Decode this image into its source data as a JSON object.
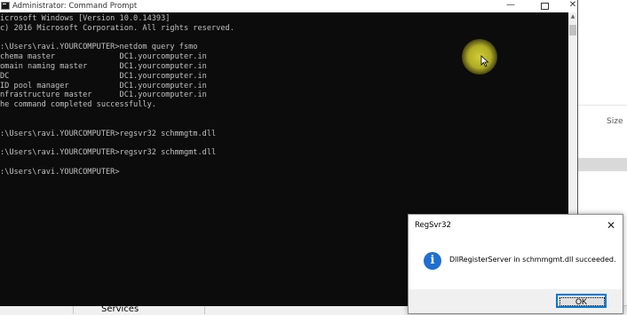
{
  "cmd_window": {
    "title": "Administrator: Command Prompt",
    "minimize_glyph": "—",
    "close_glyph": "✕",
    "console_lines": [
      "icrosoft Windows [Version 10.0.14393]",
      "c) 2016 Microsoft Corporation. All rights reserved.",
      "",
      ":\\Users\\ravi.YOURCOMPUTER>netdom query fsmo",
      "chema master              DC1.yourcomputer.in",
      "omain naming master       DC1.yourcomputer.in",
      "DC                        DC1.yourcomputer.in",
      "ID pool manager           DC1.yourcomputer.in",
      "nfrastructure master      DC1.yourcomputer.in",
      "he command completed successfully.",
      "",
      "",
      ":\\Users\\ravi.YOURCOMPUTER>regsvr32 schmmgtm.dll",
      "",
      ":\\Users\\ravi.YOURCOMPUTER>regsvr32 schmmgmt.dll",
      "",
      ":\\Users\\ravi.YOURCOMPUTER>"
    ]
  },
  "background_window": {
    "column_header": "Size"
  },
  "taskbar": {
    "item": "Services"
  },
  "dialog": {
    "title": "RegSvr32",
    "close_glyph": "✕",
    "icon_glyph": "i",
    "message": "DllRegisterServer in schmmgmt.dll succeeded.",
    "ok_label": "OK"
  },
  "colors": {
    "console_bg": "#0c0c0c",
    "console_text": "#c0c0c0",
    "info_icon": "#1f6fd1",
    "focus_border": "#0078d7"
  }
}
